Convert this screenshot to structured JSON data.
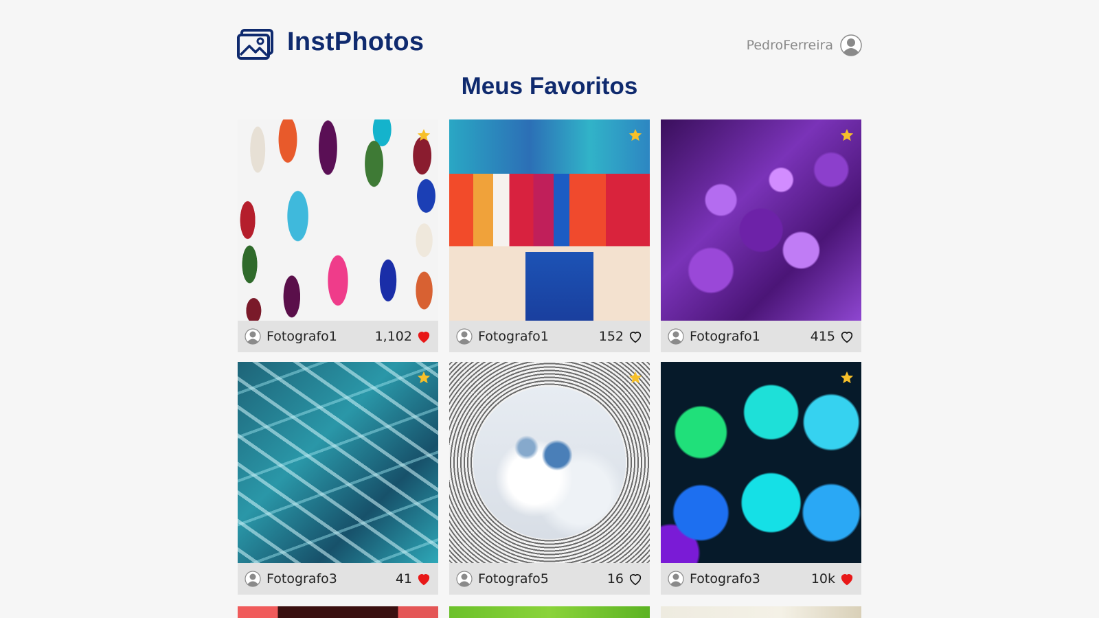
{
  "app": {
    "name": "InstPhotos"
  },
  "header": {
    "username": "PedroFerreira"
  },
  "page": {
    "title": "Meus Favoritos"
  },
  "colors": {
    "brand": "#0f2a6e",
    "star": "#f7c02a",
    "heart_liked": "#e81818",
    "card_footer": "#e2e2e2",
    "background": "#f6f6f6"
  },
  "photos": [
    {
      "author": "Fotografo1",
      "likes": "1,102",
      "liked": true,
      "favorite": true,
      "art": "gloves"
    },
    {
      "author": "Fotografo1",
      "likes": "152",
      "liked": false,
      "favorite": true,
      "art": "paint"
    },
    {
      "author": "Fotografo1",
      "likes": "415",
      "liked": false,
      "favorite": true,
      "art": "crystal"
    },
    {
      "author": "Fotografo3",
      "likes": "41",
      "liked": true,
      "favorite": true,
      "art": "river"
    },
    {
      "author": "Fotografo5",
      "likes": "16",
      "liked": false,
      "favorite": true,
      "art": "sky"
    },
    {
      "author": "Fotografo3",
      "likes": "10k",
      "liked": true,
      "favorite": true,
      "art": "hex"
    }
  ],
  "icons": {
    "logo": "image-gallery-icon",
    "user": "user-avatar-icon",
    "favorite": "star-icon",
    "like": "heart-icon"
  }
}
